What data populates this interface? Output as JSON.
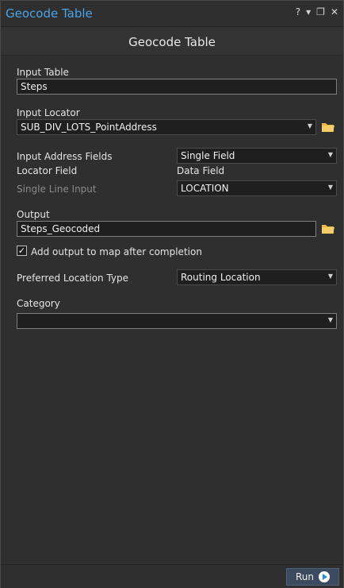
{
  "window": {
    "title": "Geocode Table",
    "controls": {
      "help": "?",
      "menu": "▾",
      "restore": "❐",
      "close": "✕"
    }
  },
  "tool": {
    "title": "Geocode Table"
  },
  "form": {
    "input_table": {
      "label": "Input Table",
      "value": "Steps"
    },
    "input_locator": {
      "label": "Input Locator",
      "value": "SUB_DIV_LOTS_PointAddress"
    },
    "input_address_fields": {
      "label": "Input Address Fields",
      "value": "Single Field"
    },
    "mapping_headers": {
      "locator_field": "Locator Field",
      "data_field": "Data Field"
    },
    "single_line_input": {
      "label": "Single Line Input",
      "value": "LOCATION"
    },
    "output": {
      "label": "Output",
      "value": "Steps_Geocoded"
    },
    "add_to_map": {
      "label": "Add output to map after completion",
      "checked": true
    },
    "preferred_location_type": {
      "label": "Preferred Location Type",
      "value": "Routing Location"
    },
    "category": {
      "label": "Category",
      "value": ""
    }
  },
  "footer": {
    "run_label": "Run"
  },
  "colors": {
    "accent": "#4aa3e8",
    "background": "#2f2f2f",
    "folder": "#e8b84a"
  }
}
